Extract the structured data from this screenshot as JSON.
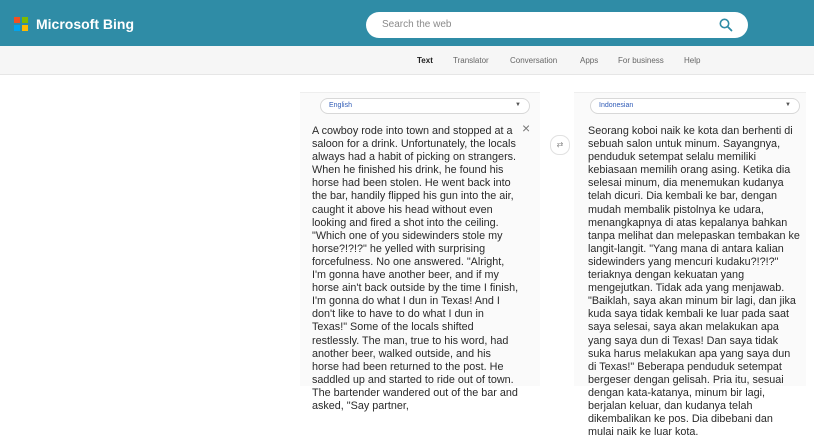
{
  "header": {
    "brand": "Microsoft Bing",
    "search_placeholder": "Search the web",
    "logo_colors": [
      "#f25022",
      "#7fba00",
      "#00a4ef",
      "#ffb900"
    ]
  },
  "nav": {
    "items": [
      "Text",
      "Translator",
      "Conversation",
      "Apps",
      "For business",
      "Help"
    ],
    "active": "Text"
  },
  "source": {
    "language": "English",
    "text": "A cowboy rode into town and stopped at a saloon for a drink. Unfortunately, the locals always had a habit of picking on strangers. When he finished his drink, he found his horse had been stolen. He went back into the bar, handily flipped his gun into the air, caught it above his head without even looking and fired a shot into the ceiling. \"Which one of you sidewinders stole my horse?!?!?\" he yelled with surprising forcefulness. No one answered. \"Alright, I'm gonna have another beer, and if my horse ain't back outside by the time I finish, I'm gonna do what I dun in Texas! And I don't like to have to do what I dun in Texas!\" Some of the locals shifted restlessly. The man, true to his word, had another beer, walked outside, and his horse had been returned to the post. He saddled up and started to ride out of town. The bartender wandered out of the bar and asked, \"Say partner,"
  },
  "target": {
    "language": "Indonesian",
    "text": "Seorang koboi naik ke kota dan berhenti di sebuah salon untuk minum. Sayangnya, penduduk setempat selalu memiliki kebiasaan memilih orang asing. Ketika dia selesai minum, dia menemukan kudanya telah dicuri. Dia kembali ke bar, dengan mudah membalik pistolnya ke udara, menangkapnya di atas kepalanya bahkan tanpa melihat dan melepaskan tembakan ke langit-langit. \"Yang mana di antara kalian sidewinders yang mencuri kudaku?!?!?\" teriaknya dengan kekuatan yang mengejutkan. Tidak ada yang menjawab. \"Baiklah, saya akan minum bir lagi, dan jika kuda saya tidak kembali ke luar pada saat saya selesai, saya akan melakukan apa yang saya dun di Texas! Dan saya tidak suka harus melakukan apa yang saya dun di Texas!\" Beberapa penduduk setempat bergeser dengan gelisah. Pria itu, sesuai dengan kata-katanya, minum bir lagi, berjalan keluar, dan kudanya telah dikembalikan ke pos. Dia dibebani dan mulai naik ke luar kota."
  },
  "icons": {
    "search": "search-icon",
    "clear": "close-icon",
    "swap": "swap-icon",
    "dropdown": "chevron-down-icon"
  },
  "colors": {
    "header": "#2f8ca6",
    "search_icon": "#2f8ca6",
    "lang_text": "#2f5bb7"
  }
}
